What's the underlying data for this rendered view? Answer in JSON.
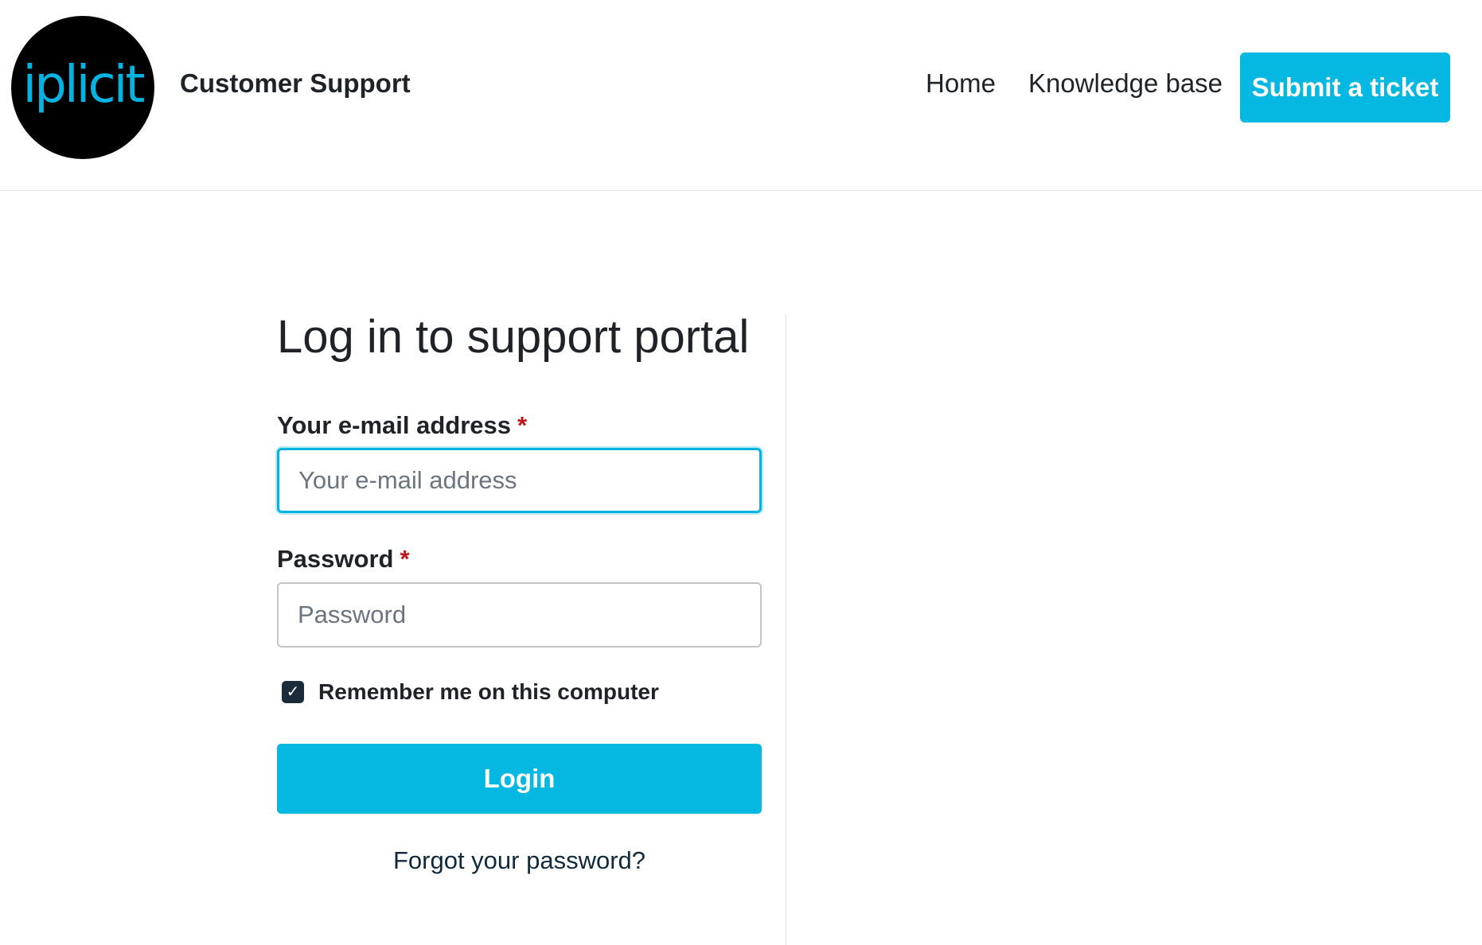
{
  "header": {
    "logo_text": "iplicit",
    "brand_title": "Customer Support",
    "nav": {
      "home": "Home",
      "knowledge_base": "Knowledge base",
      "submit_ticket": "Submit a ticket"
    }
  },
  "login_form": {
    "title": "Log in to support portal",
    "email": {
      "label": "Your e-mail address",
      "required_marker": "*",
      "placeholder": "Your e-mail address",
      "value": ""
    },
    "password": {
      "label": "Password",
      "required_marker": "*",
      "placeholder": "Password",
      "value": ""
    },
    "remember_me": {
      "label": "Remember me on this computer",
      "checked": true,
      "check_glyph": "✓"
    },
    "login_button": "Login",
    "forgot_password": "Forgot your password?"
  },
  "colors": {
    "accent": "#05b8e2",
    "logo_background": "#000000",
    "required": "#c0141c",
    "checkbox": "#1c2b3a"
  },
  "icons": {
    "checkbox": "check-icon"
  }
}
